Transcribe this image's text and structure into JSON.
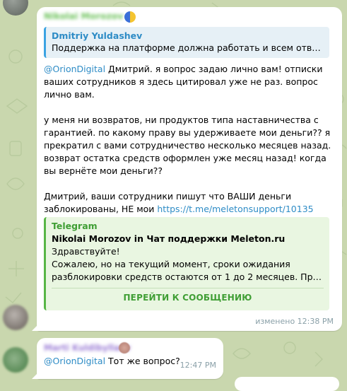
{
  "main_message": {
    "sender_name": "Nikolai Morozov",
    "reply": {
      "author": "Dmitriy Yuldashev",
      "text": "Поддержка на платформе должна работать и всем отвечает. ..."
    },
    "paragraph1_mention": "@OrionDigital",
    "paragraph1_text": " Дмитрий. я вопрос задаю лично вам! отписки ваших сотрудников я здесь цитировал уже не раз. вопрос лично вам.",
    "paragraph2_text": "у меня ни возвратов, ни продуктов типа наставничества с гарантией. по какому праву вы удерживаете мои деньги?? я прекратил с вами сотрудничество несколько месяцев назад. возврат остатка средств оформлен уже месяц назад! когда вы вернёте мои деньги??",
    "paragraph3_text": "Дмитрий, ваши сотрудники пишут что ВАШИ деньги заблокированы, НЕ мои ",
    "paragraph3_link": "https://t.me/meletonsupport/10135",
    "link_preview": {
      "site_name": "Telegram",
      "title": "Nikolai Morozov in Чат поддержки Meleton.ru",
      "line1": "Здравствуйте!",
      "line2": "Сожалею, но на текущий момент, сроки ожидания",
      "line3": "разблокировки средств остаются от 1 до 2 месяцев. Приноси...",
      "button_label": "ПЕРЕЙТИ К СООБЩЕНИЮ"
    },
    "meta": "изменено 12:38 PM"
  },
  "second_message": {
    "sender_name": "Marti Kuldibyllaev",
    "mention": "@OrionDigital",
    "text": " Тот же вопрос?",
    "time": "12:47 PM"
  }
}
